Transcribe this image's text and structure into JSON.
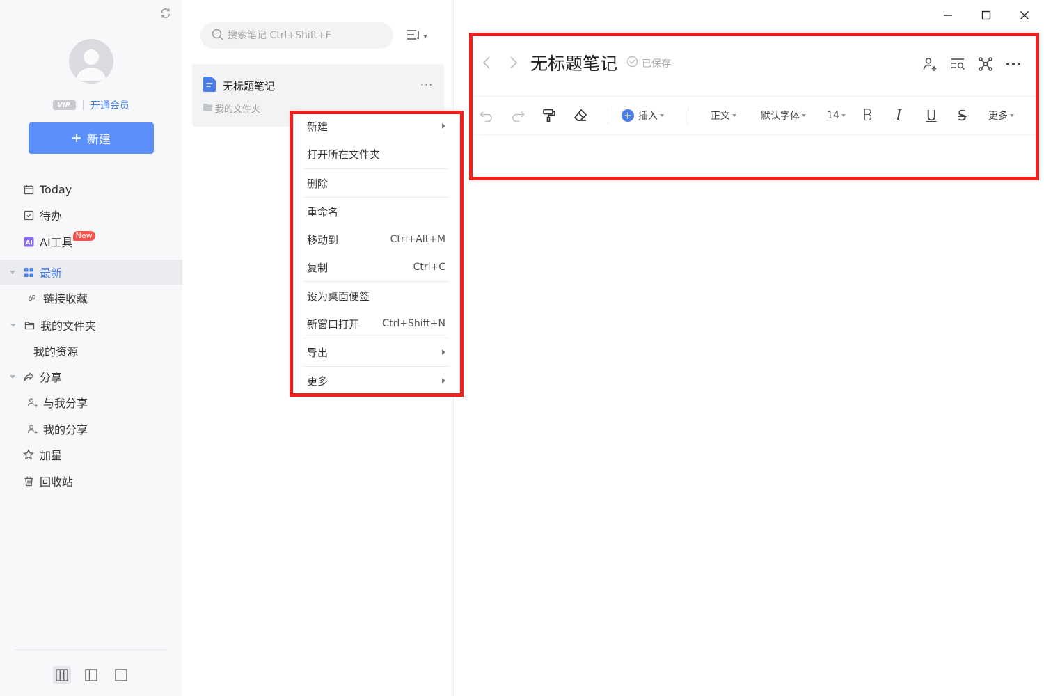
{
  "sidebar": {
    "vip_badge": "VIP",
    "vip_link": "开通会员",
    "new_button": "新建",
    "nav": {
      "today": "Today",
      "todo": "待办",
      "ai_tools": "AI工具",
      "ai_new_tag": "New",
      "latest": "最新",
      "links": "链接收藏",
      "my_folder": "我的文件夹",
      "my_resources": "我的资源",
      "share": "分享",
      "shared_with_me": "与我分享",
      "my_shares": "我的分享",
      "starred": "加星",
      "trash": "回收站"
    }
  },
  "list": {
    "search_placeholder": "搜索笔记 Ctrl+Shift+F",
    "note": {
      "title": "无标题笔记",
      "folder": "我的文件夹",
      "more": "···"
    }
  },
  "context_menu": {
    "new": "新建",
    "open_folder": "打开所在文件夹",
    "delete": "删除",
    "rename": "重命名",
    "move_to": "移动到",
    "move_to_shortcut": "Ctrl+Alt+M",
    "copy": "复制",
    "copy_shortcut": "Ctrl+C",
    "set_sticky": "设为桌面便签",
    "new_window": "新窗口打开",
    "new_window_shortcut": "Ctrl+Shift+N",
    "export": "导出",
    "more": "更多"
  },
  "editor": {
    "title": "无标题笔记",
    "saved_status": "已保存",
    "toolbar": {
      "insert": "插入",
      "paragraph": "正文",
      "font": "默认字体",
      "font_size": "14",
      "bold": "B",
      "italic": "I",
      "underline": "U",
      "strike": "S",
      "more": "更多"
    }
  },
  "colors": {
    "accent": "#5b8ff9",
    "highlight": "#f0201c",
    "new_tag": "#f4524d"
  }
}
